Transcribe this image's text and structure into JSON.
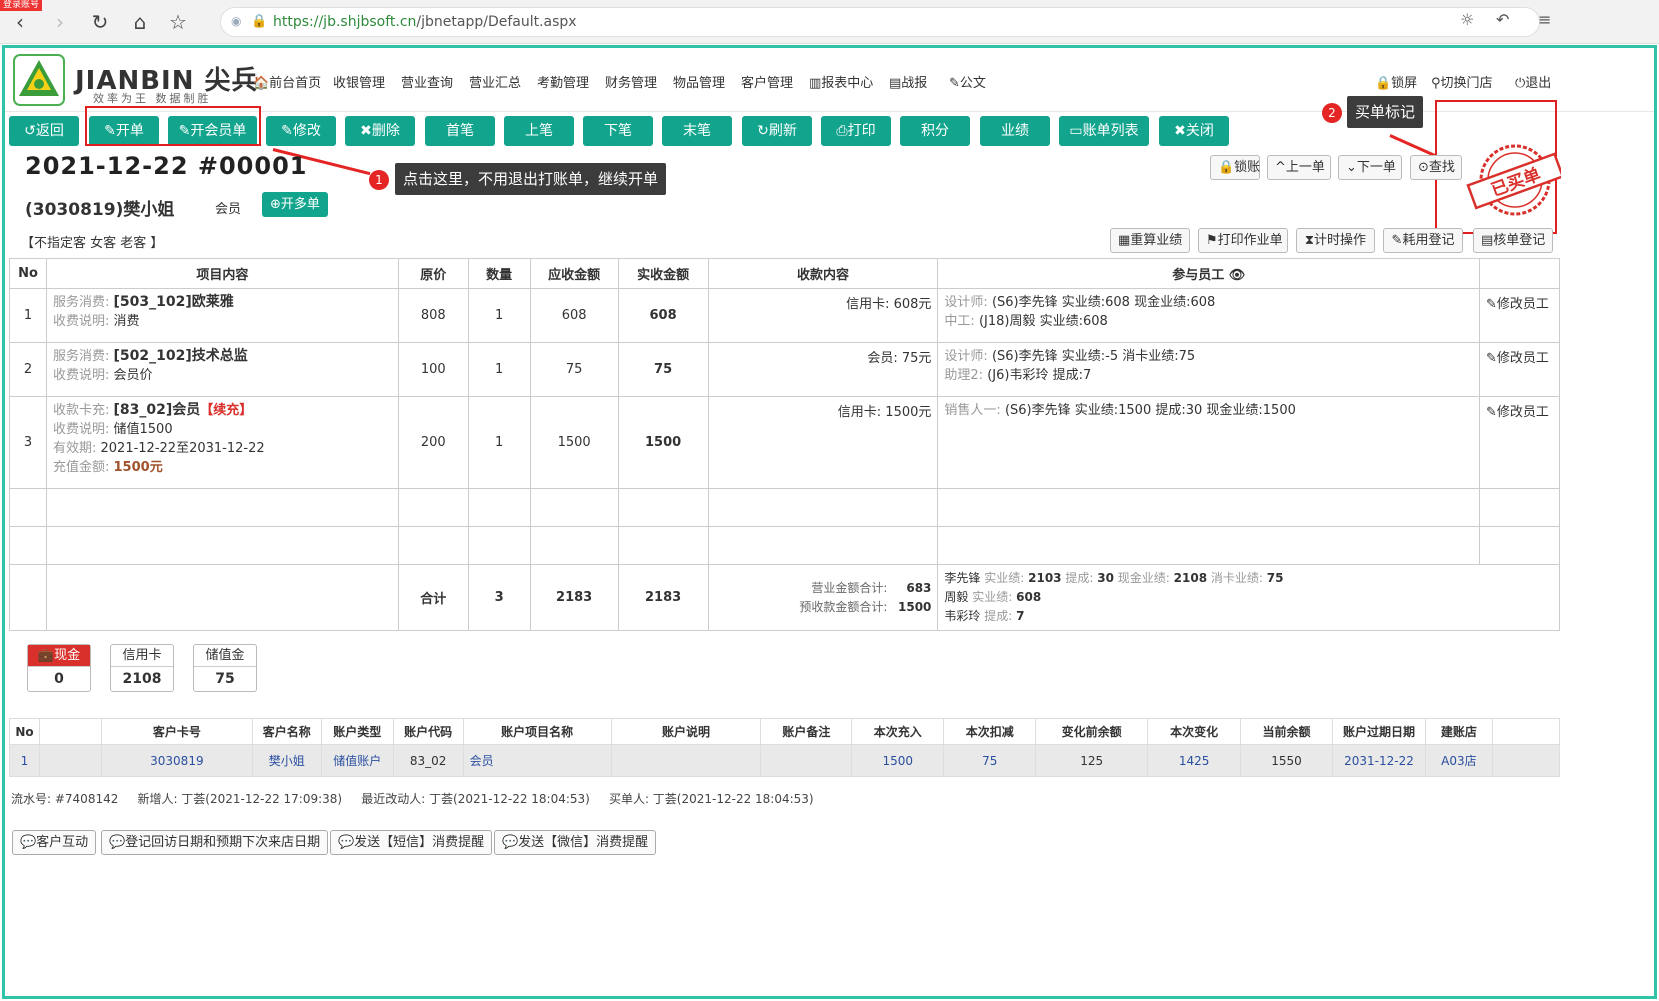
{
  "browser": {
    "url_host": "https://jb.shjbsoft.cn",
    "url_path": "/jbnetapp/Default.aspx",
    "corner_tag": "登录账号"
  },
  "brand": {
    "name": "JIANBIN 尖兵",
    "slogan": "效率为王 数据制胜"
  },
  "top_nav": [
    {
      "label": "🏠前台首页"
    },
    {
      "label": "收银管理"
    },
    {
      "label": "营业查询"
    },
    {
      "label": "营业汇总"
    },
    {
      "label": "考勤管理"
    },
    {
      "label": "财务管理"
    },
    {
      "label": "物品管理"
    },
    {
      "label": "客户管理"
    },
    {
      "label": "▥报表中心"
    },
    {
      "label": "▤战报"
    },
    {
      "label": "✎公文"
    }
  ],
  "top_right": [
    {
      "label": "🔒锁屏"
    },
    {
      "label": "⚲切换门店"
    },
    {
      "label": "⏻退出"
    }
  ],
  "toolbar": [
    {
      "label": "↺返回"
    },
    {
      "label": "✎开单"
    },
    {
      "label": "✎开会员单"
    },
    {
      "label": "✎修改"
    },
    {
      "label": "✖删除"
    },
    {
      "label": "首笔"
    },
    {
      "label": "上笔"
    },
    {
      "label": "下笔"
    },
    {
      "label": "末笔"
    },
    {
      "label": "↻刷新"
    },
    {
      "label": "⎙打印"
    },
    {
      "label": "积分"
    },
    {
      "label": "业绩"
    },
    {
      "label": "▭账单列表"
    },
    {
      "label": "✖关闭"
    }
  ],
  "callouts": {
    "one_num": "1",
    "one_text": "点击这里，不用退出打账单，继续开单",
    "two_num": "2",
    "two_text": "买单标记"
  },
  "order": {
    "title": "2021-12-22  #00001",
    "customer": "(3030819)樊小姐",
    "member_type": "会员",
    "multi_label": "⊕开多单",
    "tags": "【不指定客 女客 老客 】"
  },
  "nav_buttons": [
    {
      "label": "🔒锁账"
    },
    {
      "label": "^上一单"
    },
    {
      "label": "⌄下一单"
    },
    {
      "label": "⊙查找"
    }
  ],
  "action_buttons": [
    {
      "label": "▦重算业绩"
    },
    {
      "label": "⚑打印作业单"
    },
    {
      "label": "⧗计时操作"
    },
    {
      "label": "✎耗用登记"
    },
    {
      "label": "▤核单登记"
    }
  ],
  "stamp": {
    "text": "已买单",
    "color": "#d9302b"
  },
  "table_headers": [
    "No",
    "项目内容",
    "原价",
    "数量",
    "应收金额",
    "实收金额",
    "收款内容",
    "参与员工 👁",
    ""
  ],
  "rows": [
    {
      "no": "1",
      "lines": [
        {
          "label": "服务消费:",
          "value": "[503_102]欧莱雅"
        },
        {
          "label": "收费说明:",
          "value": "消费"
        }
      ],
      "price": "808",
      "qty": "1",
      "due": "608",
      "paid": "608",
      "payment": "信用卡:  608元",
      "staff": [
        {
          "label": "设计师:",
          "value": "(S6)李先锋",
          "extra": "实业绩:608 现金业绩:608"
        },
        {
          "label": "中工:",
          "value": "(J18)周毅",
          "extra": "实业绩:608"
        }
      ],
      "edit": "✎修改员工"
    },
    {
      "no": "2",
      "lines": [
        {
          "label": "服务消费:",
          "value": "[502_102]技术总监"
        },
        {
          "label": "收费说明:",
          "value": "会员价"
        }
      ],
      "price": "100",
      "qty": "1",
      "due": "75",
      "paid": "75",
      "payment": "会员:  75元",
      "staff": [
        {
          "label": "设计师:",
          "value": "(S6)李先锋",
          "extra": "实业绩:-5 消卡业绩:75"
        },
        {
          "label": "助理2:",
          "value": "(J6)韦彩玲",
          "extra": "提成:7"
        }
      ],
      "edit": "✎修改员工"
    },
    {
      "no": "3",
      "lines": [
        {
          "label": "收款卡充:",
          "value": "[83_02]会员",
          "tag": "【续充】"
        },
        {
          "label": "收费说明:",
          "value": "储值1500"
        },
        {
          "label": "有效期:",
          "value": "2021-12-22至2031-12-22"
        },
        {
          "label": "充值金额:",
          "value": "1500元",
          "brown": true
        }
      ],
      "price": "200",
      "qty": "1",
      "due": "1500",
      "paid": "1500",
      "payment": "信用卡:  1500元",
      "staff": [
        {
          "label": "销售人一:",
          "value": "(S6)李先锋",
          "extra": "实业绩:1500 提成:30 现金业绩:1500"
        }
      ],
      "edit": "✎修改员工"
    }
  ],
  "totals": {
    "label": "合计",
    "qty": "3",
    "due": "2183",
    "paid": "2183",
    "biz_label": "营业金额合计:",
    "biz_value": "683",
    "pre_label": "预收款金额合计:",
    "pre_value": "1500",
    "staff_lines": [
      {
        "name": "李先锋",
        "items": [
          [
            "实业绩:",
            "2103"
          ],
          [
            "提成:",
            "30"
          ],
          [
            "现金业绩:",
            "2108"
          ],
          [
            "消卡业绩:",
            "75"
          ]
        ]
      },
      {
        "name": "周毅",
        "items": [
          [
            "实业绩:",
            "608"
          ]
        ]
      },
      {
        "name": "韦彩玲",
        "items": [
          [
            "提成:",
            "7"
          ]
        ]
      }
    ]
  },
  "payments": [
    {
      "label": "💼现金",
      "value": "0",
      "active": true
    },
    {
      "label": "信用卡",
      "value": "2108",
      "active": false
    },
    {
      "label": "储值金",
      "value": "75",
      "active": false
    }
  ],
  "account_headers": [
    "No",
    "",
    "客户卡号",
    "客户名称",
    "账户类型",
    "账户代码",
    "账户项目名称",
    "账户说明",
    "账户备注",
    "本次充入",
    "本次扣减",
    "变化前余额",
    "本次变化",
    "当前余额",
    "账户过期日期",
    "建账店",
    ""
  ],
  "account_rows": [
    [
      "1",
      "",
      "3030819",
      "樊小姐",
      "储值账户",
      "83_02",
      "会员",
      "",
      "",
      "1500",
      "75",
      "125",
      "1425",
      "1550",
      "2031-12-22",
      "A03店",
      ""
    ]
  ],
  "footer": {
    "serial": "流水号: #7408142",
    "created": "新增人: 丁荟(2021-12-22 17:09:38)",
    "modified": "最近改动人: 丁荟(2021-12-22 18:04:53)",
    "buyer": "买单人: 丁荟(2021-12-22 18:04:53)"
  },
  "footer_buttons": [
    {
      "label": "💬客户互动"
    },
    {
      "label": "💬登记回访日期和预期下次来店日期"
    },
    {
      "label": "💬发送【短信】消费提醒"
    },
    {
      "label": "💬发送【微信】消费提醒"
    }
  ]
}
